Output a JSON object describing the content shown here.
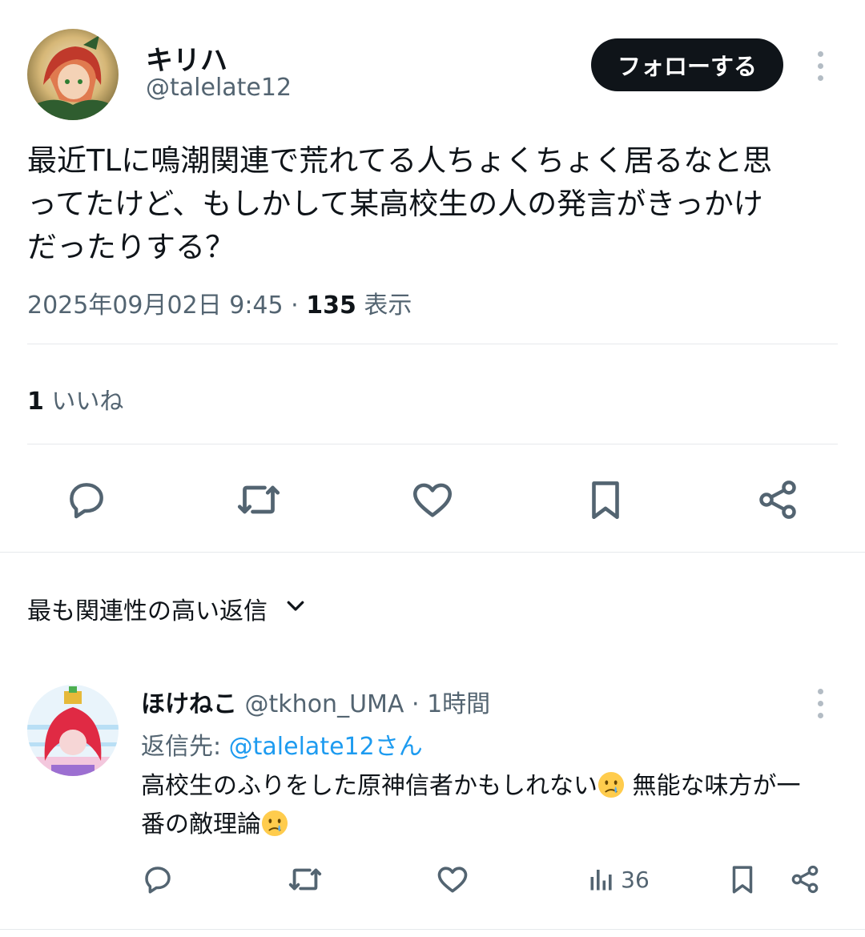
{
  "tweet": {
    "author": {
      "name": "キリハ",
      "handle": "@talelate12"
    },
    "follow_label": "フォローする",
    "text_lines": [
      "最近TLに鳴潮関連で荒れてる人ちょくちょく居るなと思",
      "ってたけど、もしかして某高校生の人の発言がきっかけ",
      "だったりする？"
    ],
    "timestamp": "2025年09月02日 9:45",
    "separator": "·",
    "views_count": "135",
    "views_label": "表示",
    "likes_count": "1",
    "likes_label": "いいね",
    "actions": [
      "reply-icon",
      "retweet-icon",
      "like-icon",
      "bookmark-icon",
      "share-icon"
    ]
  },
  "replies_sort": {
    "label": "最も関連性の高い返信",
    "icon": "chevron-down-icon"
  },
  "reply": {
    "name": "ほけねこ",
    "handle": "@tkhon_UMA",
    "separator": "·",
    "time": "1時間",
    "reply_to_label": "返信先: ",
    "reply_to_user": "@talelate12さん",
    "text_part1": "高校生のふりをした原神信者かもしれない",
    "text_part2": " 無能な味方が一",
    "text_part3": "番の敵理論",
    "emoji": "crying-face-emoji",
    "views_count": "36",
    "actions": [
      "reply-icon",
      "retweet-icon",
      "like-icon",
      "views-icon",
      "bookmark-icon",
      "share-icon"
    ]
  },
  "colors": {
    "text_primary": "#0f1419",
    "text_secondary": "#536471",
    "link": "#1d9bf0",
    "follow_bg": "#0f1419",
    "divider": "#e6e9ec"
  }
}
